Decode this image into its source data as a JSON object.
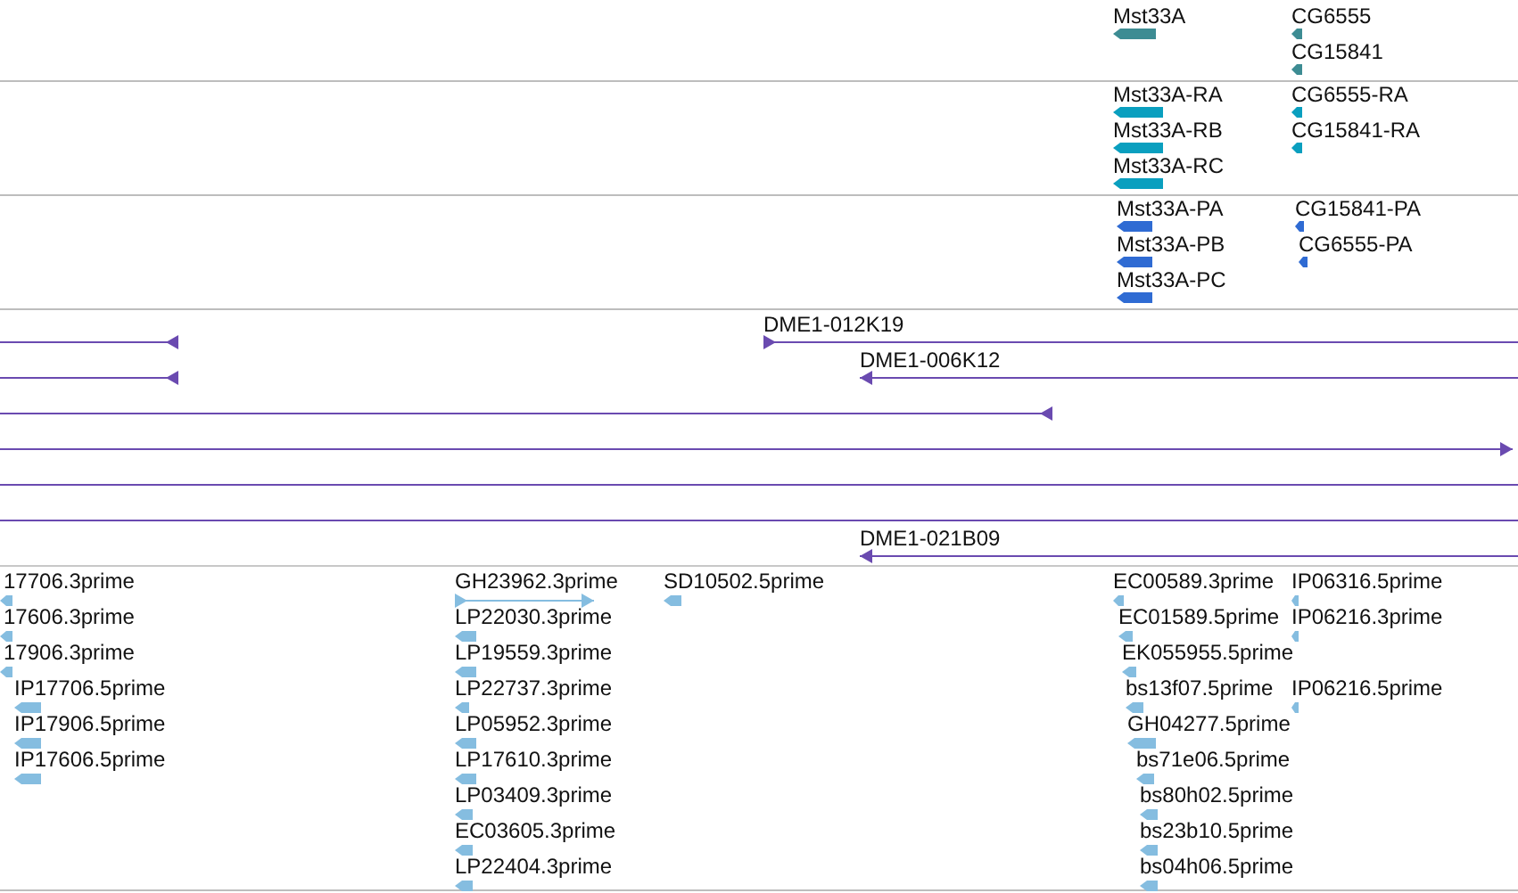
{
  "gene_track": {
    "features": [
      {
        "label": "Mst33A",
        "reverse": true
      },
      {
        "label": "CG6555",
        "reverse": true
      },
      {
        "label": "CG15841",
        "reverse": true
      }
    ]
  },
  "transcript_track": {
    "features": [
      {
        "label": "Mst33A-RA",
        "reverse": true
      },
      {
        "label": "Mst33A-RB",
        "reverse": true
      },
      {
        "label": "Mst33A-RC",
        "reverse": true
      },
      {
        "label": "CG6555-RA",
        "reverse": true
      },
      {
        "label": "CG15841-RA",
        "reverse": true
      }
    ]
  },
  "protein_track": {
    "features": [
      {
        "label": "Mst33A-PA",
        "reverse": true
      },
      {
        "label": "Mst33A-PB",
        "reverse": true
      },
      {
        "label": "Mst33A-PC",
        "reverse": true
      },
      {
        "label": "CG15841-PA",
        "reverse": true
      },
      {
        "label": "CG6555-PA",
        "reverse": true
      }
    ]
  },
  "clone_track": {
    "features": [
      {
        "kind": "arrow",
        "reverse": true
      },
      {
        "kind": "arrow",
        "label": "DME1-012K19",
        "reverse": false
      },
      {
        "kind": "arrow",
        "reverse": true
      },
      {
        "kind": "arrow",
        "label": "DME1-006K12",
        "reverse": true
      },
      {
        "kind": "arrow",
        "reverse": true
      },
      {
        "kind": "arrow",
        "reverse": false
      },
      {
        "kind": "line"
      },
      {
        "kind": "line"
      },
      {
        "kind": "arrow",
        "label": "DME1-021B09",
        "reverse": true
      }
    ]
  },
  "est_track": {
    "features": [
      {
        "label": "17706.3prime",
        "reverse": true
      },
      {
        "label": "17606.3prime",
        "reverse": true
      },
      {
        "label": "17906.3prime",
        "reverse": true
      },
      {
        "label": "IP17706.5prime",
        "reverse": true
      },
      {
        "label": "IP17906.5prime",
        "reverse": true
      },
      {
        "label": "IP17606.5prime",
        "reverse": true
      },
      {
        "label": "GH23962.3prime",
        "reverse": false
      },
      {
        "label": "LP22030.3prime",
        "reverse": true
      },
      {
        "label": "LP19559.3prime",
        "reverse": true
      },
      {
        "label": "LP22737.3prime",
        "reverse": true
      },
      {
        "label": "LP05952.3prime",
        "reverse": true
      },
      {
        "label": "LP17610.3prime",
        "reverse": true
      },
      {
        "label": "LP03409.3prime",
        "reverse": true
      },
      {
        "label": "EC03605.3prime",
        "reverse": true
      },
      {
        "label": "LP22404.3prime",
        "reverse": true
      },
      {
        "label": "SD10502.5prime",
        "reverse": true
      },
      {
        "label": "EC00589.3prime",
        "reverse": true
      },
      {
        "label": "EC01589.5prime",
        "reverse": true
      },
      {
        "label": "EK055955.5prime",
        "reverse": true
      },
      {
        "label": "bs13f07.5prime",
        "reverse": true
      },
      {
        "label": "GH04277.5prime",
        "reverse": true
      },
      {
        "label": "bs71e06.5prime",
        "reverse": true
      },
      {
        "label": "bs80h02.5prime",
        "reverse": true
      },
      {
        "label": "bs23b10.5prime",
        "reverse": true
      },
      {
        "label": "bs04h06.5prime",
        "reverse": true
      },
      {
        "label": "IP06316.5prime",
        "reverse": true
      },
      {
        "label": "IP06216.3prime",
        "reverse": true
      },
      {
        "label": "IP06216.5prime",
        "reverse": true
      }
    ]
  }
}
